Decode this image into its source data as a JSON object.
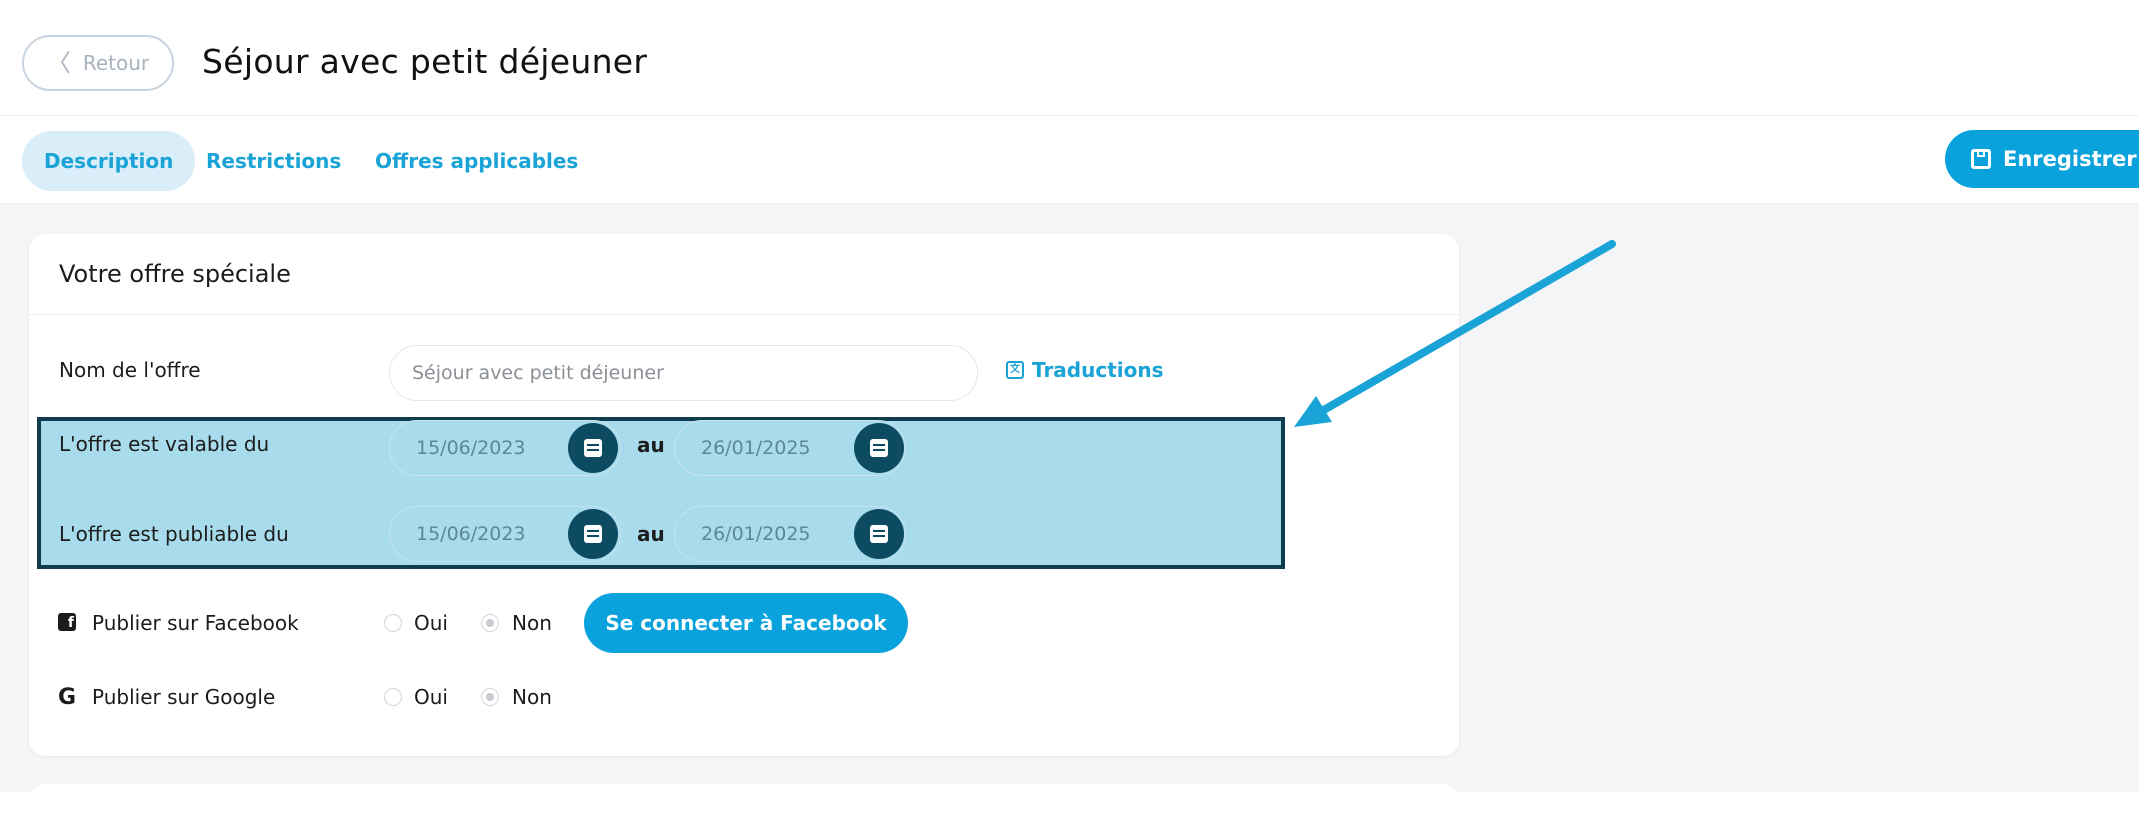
{
  "header": {
    "back_label": "Retour",
    "title": "Séjour avec petit déjeuner"
  },
  "tabs": [
    {
      "label": "Description",
      "active": true
    },
    {
      "label": "Restrictions",
      "active": false
    },
    {
      "label": "Offres applicables",
      "active": false
    }
  ],
  "toolbar": {
    "save_label": "Enregistrer"
  },
  "card": {
    "title": "Votre offre spéciale",
    "offer_name": {
      "label": "Nom de l'offre",
      "value": "Séjour avec petit déjeuner",
      "translations_label": "Traductions"
    },
    "valid_range": {
      "label": "L'offre est valable du",
      "from": "15/06/2023",
      "separator": "au",
      "to": "26/01/2025"
    },
    "publish_range": {
      "label": "L'offre est publiable du",
      "from": "15/06/2023",
      "separator": "au",
      "to": "26/01/2025"
    },
    "facebook": {
      "label": "Publier sur Facebook",
      "yes_label": "Oui",
      "no_label": "Non",
      "selected": "Non",
      "connect_label": "Se connecter à Facebook"
    },
    "google": {
      "label": "Publier sur Google",
      "yes_label": "Oui",
      "no_label": "Non",
      "selected": "Non"
    }
  },
  "colors": {
    "accent": "#0aa2dc",
    "highlight": "#a8dbec",
    "highlight_border": "#0f3d4f",
    "arrow": "#1aa3d6"
  }
}
